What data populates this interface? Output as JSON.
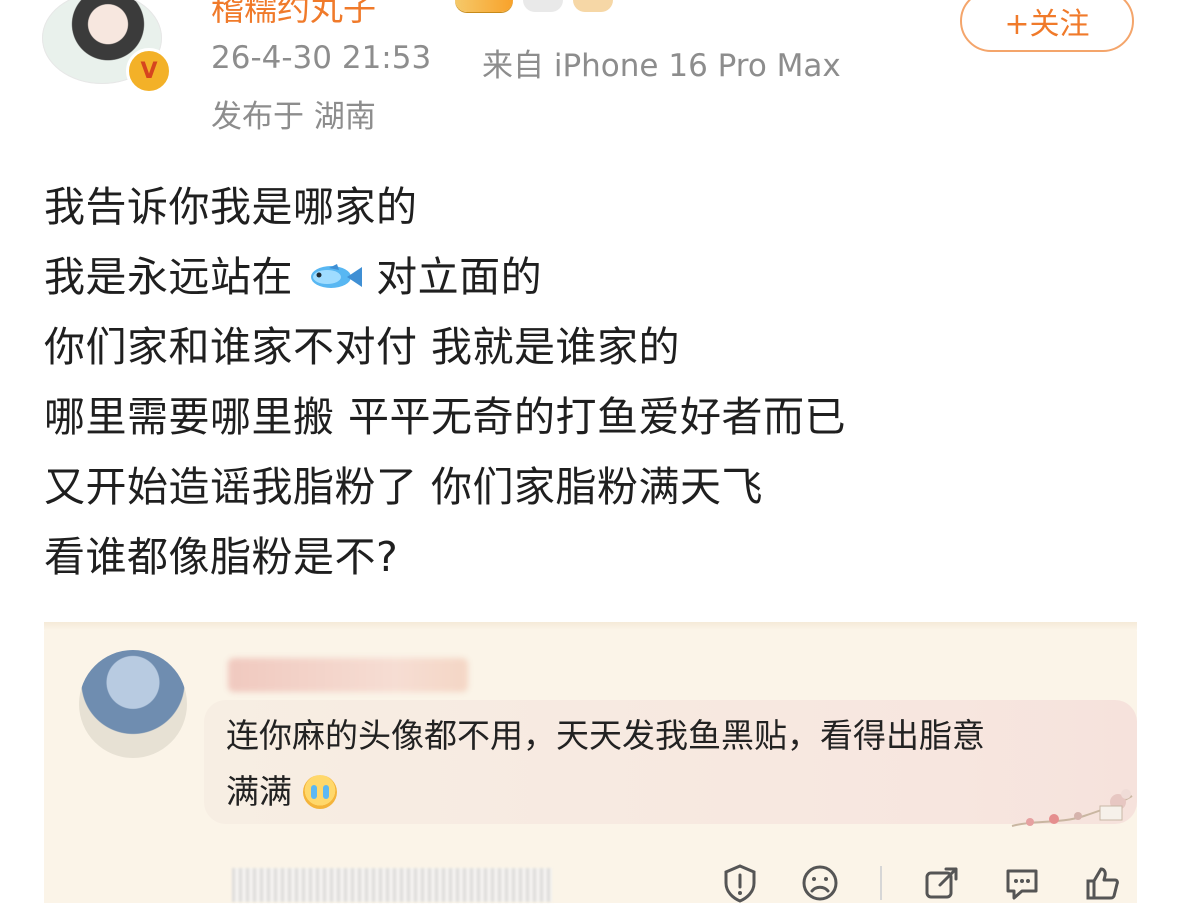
{
  "post": {
    "author_name": "稽糯约丸子",
    "timestamp": "26-4-30 21:53",
    "source": "来自 iPhone 16 Pro Max",
    "location": "发布于 湖南",
    "follow_label": "+关注",
    "lines": [
      "我告诉你我是哪家的",
      "我是永远站在",
      "对立面的",
      "你们家和谁家不对付 我就是谁家的",
      "哪里需要哪里搬 平平无奇的打鱼爱好者而已",
      "又开始造谣我脂粉了 你们家脂粉满天飞",
      "看谁都像脂粉是不?"
    ]
  },
  "comment": {
    "text_line1": "连你麻的头像都不用，天天发我鱼黑贴，看得出脂意",
    "text_line2": "满满"
  },
  "actions": {
    "items": [
      "report-icon",
      "sad-icon",
      "share-icon",
      "comment-icon",
      "like-icon"
    ]
  },
  "colors": {
    "accent": "#f07a2a",
    "meta": "#8d8d8d",
    "card": "#fbf4e8"
  }
}
